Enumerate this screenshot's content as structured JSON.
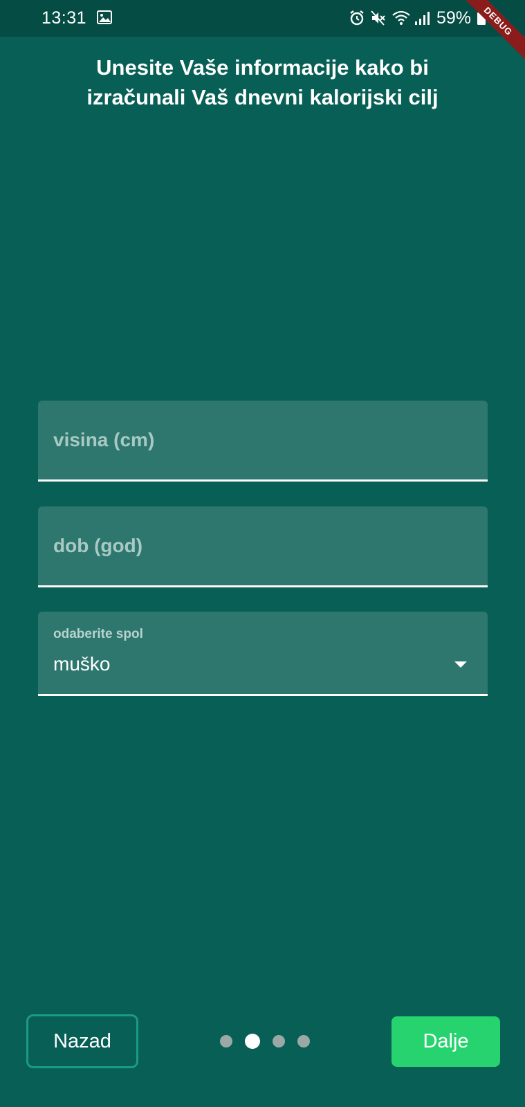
{
  "status_bar": {
    "time": "13:31",
    "battery": "59%",
    "icons": [
      "gallery-icon",
      "alarm-icon",
      "mute-icon",
      "wifi-icon",
      "signal-icon",
      "battery-icon"
    ]
  },
  "debug_banner": "DEBUG",
  "header": {
    "title_line1": "Unesite Vaše informacije kako bi",
    "title_line2": "izračunali Vaš dnevni kalorijski cilj"
  },
  "form": {
    "height_placeholder": "visina (cm)",
    "age_placeholder": "dob (god)",
    "gender_label": "odaberite spol",
    "gender_value": "muško"
  },
  "navigation": {
    "back_label": "Nazad",
    "next_label": "Dalje",
    "page_count": 4,
    "current_page": 2
  },
  "colors": {
    "background": "#075f55",
    "status_bar": "#054d44",
    "field_background": "#2e776e",
    "next_button": "#27d36f",
    "back_border": "#1c9a84",
    "debug_ribbon": "#8b1c1c"
  }
}
